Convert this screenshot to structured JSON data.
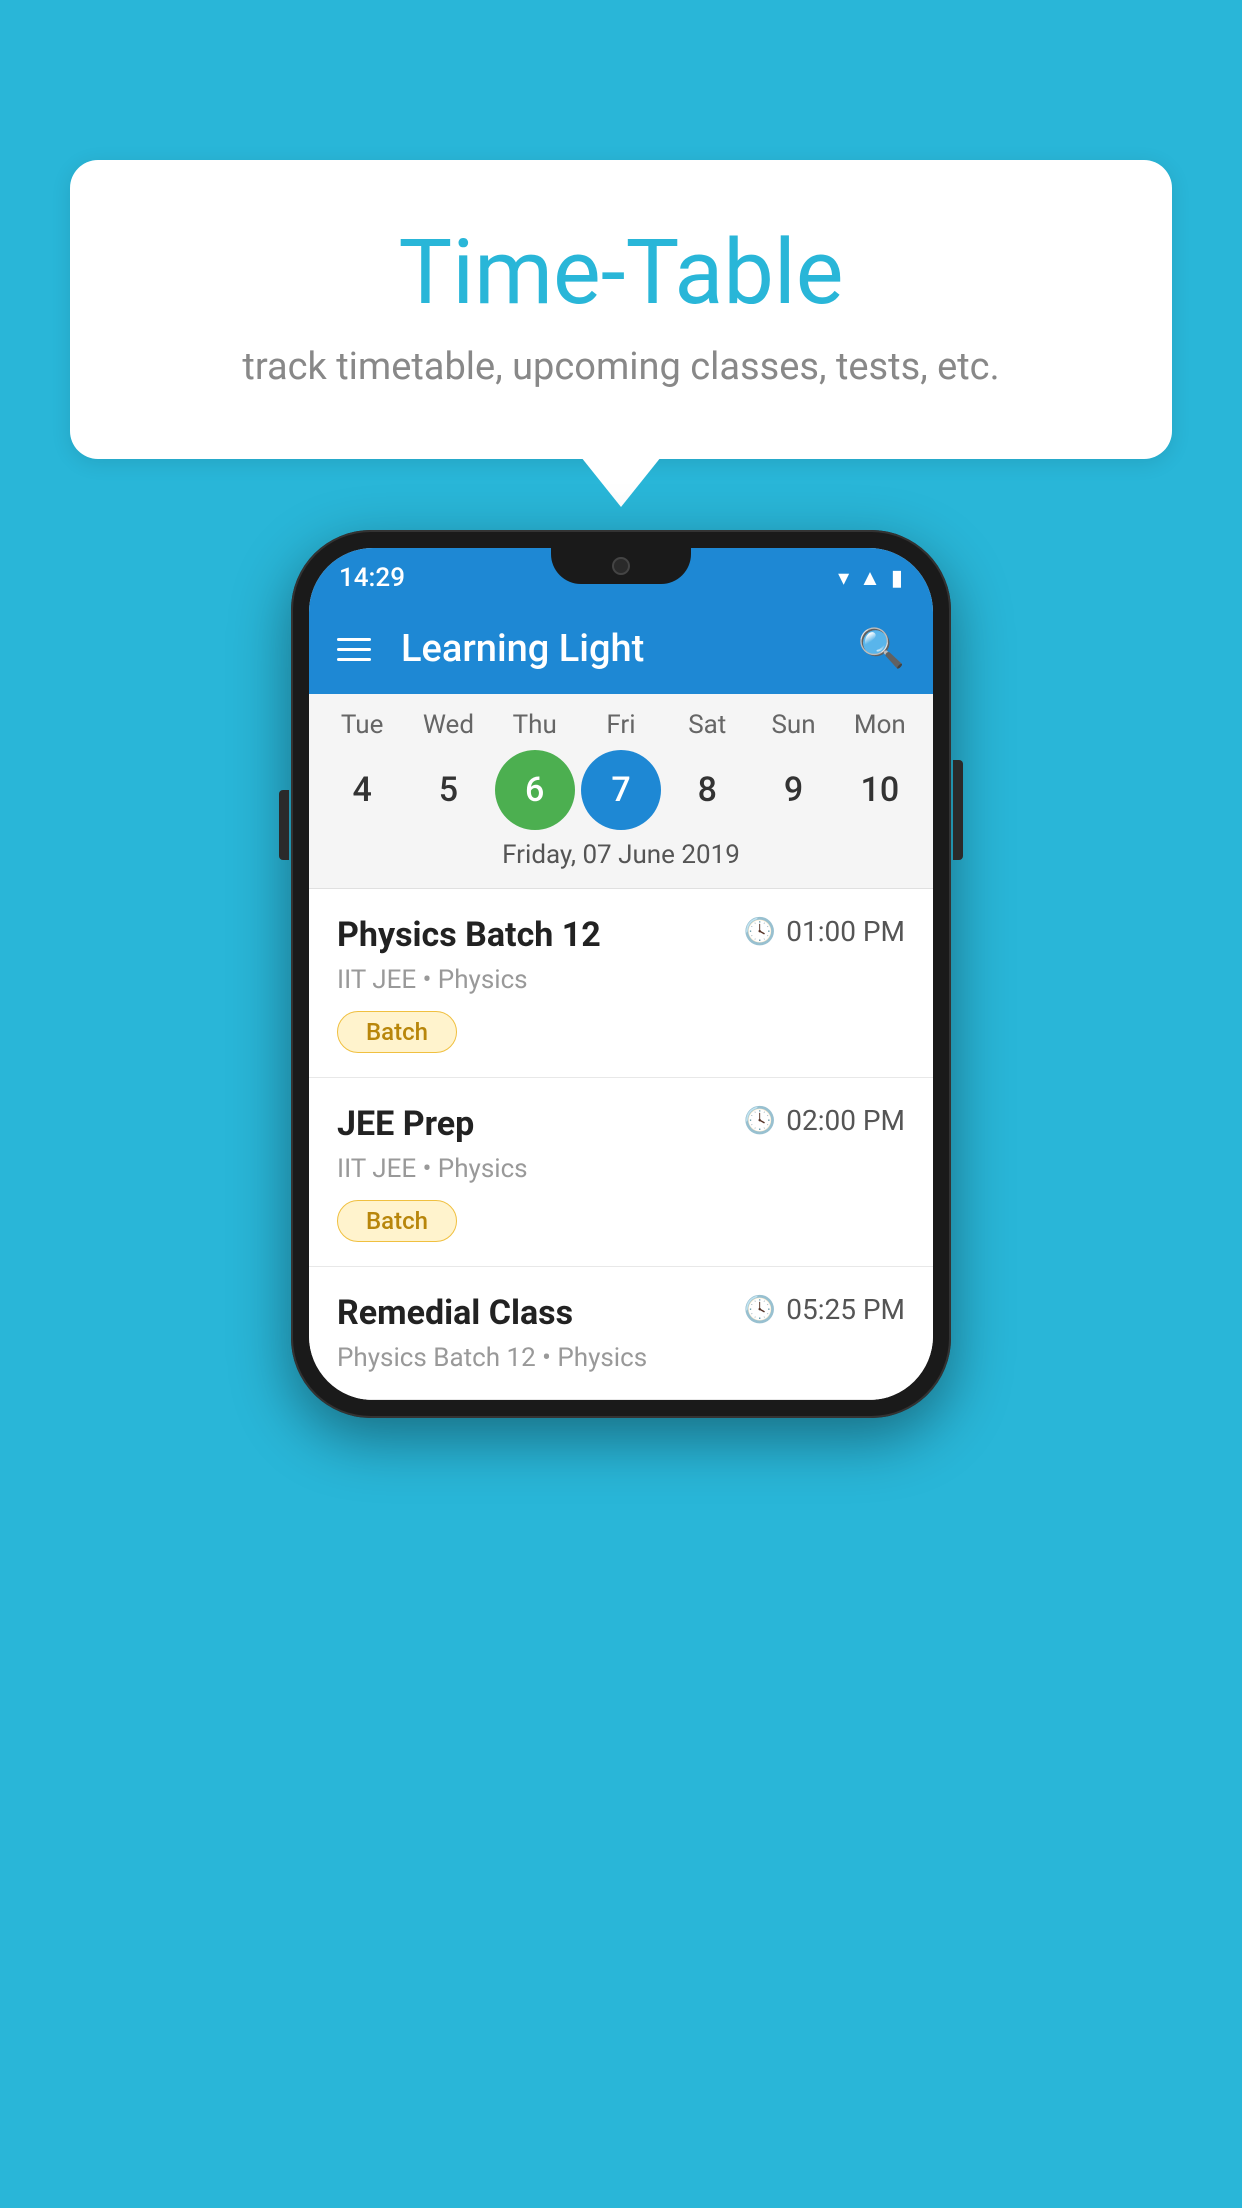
{
  "background_color": "#29B6D8",
  "bubble": {
    "title": "Time-Table",
    "subtitle": "track timetable, upcoming classes, tests, etc."
  },
  "phone": {
    "status_bar": {
      "time": "14:29"
    },
    "app_bar": {
      "title": "Learning Light"
    },
    "calendar": {
      "days": [
        {
          "name": "Tue",
          "number": "4",
          "state": "normal"
        },
        {
          "name": "Wed",
          "number": "5",
          "state": "normal"
        },
        {
          "name": "Thu",
          "number": "6",
          "state": "today"
        },
        {
          "name": "Fri",
          "number": "7",
          "state": "selected"
        },
        {
          "name": "Sat",
          "number": "8",
          "state": "normal"
        },
        {
          "name": "Sun",
          "number": "9",
          "state": "normal"
        },
        {
          "name": "Mon",
          "number": "10",
          "state": "normal"
        }
      ],
      "selected_date_label": "Friday, 07 June 2019"
    },
    "schedule": [
      {
        "title": "Physics Batch 12",
        "time": "01:00 PM",
        "meta": "IIT JEE • Physics",
        "tag": "Batch"
      },
      {
        "title": "JEE Prep",
        "time": "02:00 PM",
        "meta": "IIT JEE • Physics",
        "tag": "Batch"
      },
      {
        "title": "Remedial Class",
        "time": "05:25 PM",
        "meta": "Physics Batch 12 • Physics",
        "tag": ""
      }
    ]
  }
}
